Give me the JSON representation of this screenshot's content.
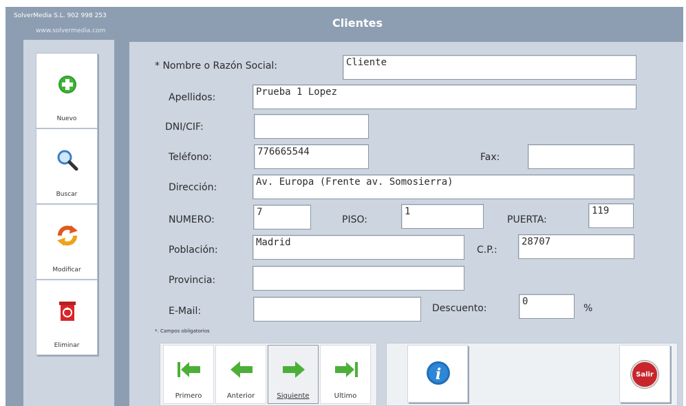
{
  "header": {
    "company_line1": "SolverMedia S.L. 902 998 253",
    "company_line2": "www.solvermedia.com",
    "title": "Clientes"
  },
  "sidebar": {
    "items": [
      {
        "label": "Nuevo",
        "icon": "plus-icon",
        "color": "#2f9b2a"
      },
      {
        "label": "Buscar",
        "icon": "magnifier-icon",
        "color": "#3a7fc7"
      },
      {
        "label": "Modificar",
        "icon": "refresh-icon",
        "color": "#e05a1c"
      },
      {
        "label": "Eliminar",
        "icon": "recycle-bin-icon",
        "color": "#d8252a"
      }
    ]
  },
  "form": {
    "nombre": {
      "label": "* Nombre o Razón Social:",
      "value": "Cliente"
    },
    "apellidos": {
      "label": "Apellidos:",
      "value": "Prueba 1 Lopez"
    },
    "dni": {
      "label": "DNI/CIF:",
      "value": ""
    },
    "telefono": {
      "label": "Teléfono:",
      "value": "776665544"
    },
    "fax": {
      "label": "Fax:",
      "value": ""
    },
    "direccion": {
      "label": "Dirección:",
      "value": "Av. Europa (Frente av. Somosierra)"
    },
    "numero": {
      "label": "NUMERO:",
      "value": "7"
    },
    "piso": {
      "label": "PISO:",
      "value": "1"
    },
    "puerta": {
      "label": "PUERTA:",
      "value": "119"
    },
    "poblacion": {
      "label": "Población:",
      "value": "Madrid"
    },
    "cp": {
      "label": "C.P.:",
      "value": "28707"
    },
    "provincia": {
      "label": "Provincia:",
      "value": ""
    },
    "email": {
      "label": "E-Mail:",
      "value": ""
    },
    "descuento": {
      "label": "Descuento:",
      "value": "0",
      "unit": "%"
    },
    "required_note": "*. Campos obligatorios"
  },
  "navigation": {
    "items": [
      {
        "label": "Primero",
        "icon": "first-record-icon"
      },
      {
        "label": "Anterior",
        "icon": "previous-record-icon"
      },
      {
        "label": "Siguiente",
        "icon": "next-record-icon"
      },
      {
        "label": "Ultimo",
        "icon": "last-record-icon"
      }
    ],
    "active": "Siguiente"
  },
  "actions": {
    "info_icon": "info-icon",
    "exit_label": "Salir",
    "exit_icon": "exit-icon"
  },
  "colors": {
    "background": "#8e9eb2",
    "panel": "#ccd5e0",
    "arrow_green": "#4caf38",
    "exit_red": "#c8262b",
    "info_blue": "#1f6fb8"
  }
}
